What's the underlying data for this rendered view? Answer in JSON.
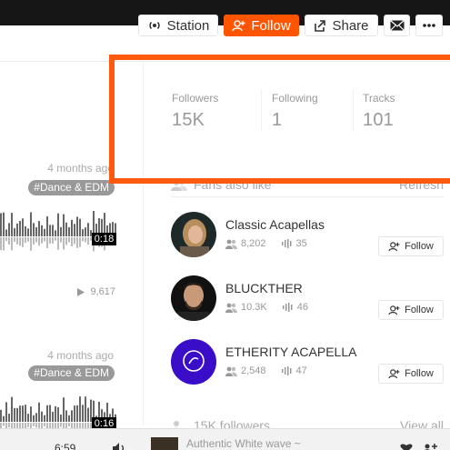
{
  "actions": {
    "station": "Station",
    "follow": "Follow",
    "share": "Share",
    "accent": "#ff5500"
  },
  "stats": [
    {
      "label": "Followers",
      "value": "15K"
    },
    {
      "label": "Following",
      "value": "1"
    },
    {
      "label": "Tracks",
      "value": "101"
    }
  ],
  "tracks": [
    {
      "ago": "4 months ago",
      "tag": "#Dance & EDM",
      "duration": "0:18",
      "plays": "9,617"
    },
    {
      "ago": "4 months ago",
      "tag": "#Dance & EDM",
      "duration": "0:16"
    }
  ],
  "fans_section": {
    "title": "Fans also like",
    "refresh": "Refresh",
    "follow_label": "Follow",
    "artists": [
      {
        "name": "Classic Acapellas",
        "followers": "8,202",
        "tracks": "35"
      },
      {
        "name": "BLUCKTHER",
        "followers": "10.3K",
        "tracks": "46"
      },
      {
        "name": "ETHERITY ACAPELLA",
        "followers": "2,548",
        "tracks": "47"
      }
    ]
  },
  "followers_section": {
    "title": "15K followers",
    "view_all": "View all"
  },
  "player": {
    "time": "6:59",
    "track_title": "Authentic White wave ~"
  }
}
